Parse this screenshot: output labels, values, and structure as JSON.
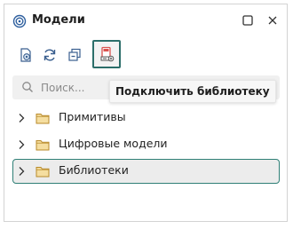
{
  "window": {
    "title": "Модели",
    "app_icon": "spiral-logo-icon",
    "maximize_icon": "maximize-icon",
    "close_icon": "close-icon"
  },
  "toolbar": {
    "buttons": [
      {
        "icon": "document-view-icon"
      },
      {
        "icon": "refresh-icon"
      },
      {
        "icon": "collapse-all-icon"
      },
      {
        "icon": "connect-library-icon",
        "active": true
      }
    ]
  },
  "tooltip": {
    "text": "Подключить библиотеку"
  },
  "search": {
    "placeholder": "Поиск...",
    "value": "",
    "icon": "search-icon"
  },
  "tree": {
    "items": [
      {
        "label": "Примитивы",
        "icon": "folder-icon"
      },
      {
        "label": "Цифровые модели",
        "icon": "folder-icon"
      },
      {
        "label": "Библиотеки",
        "icon": "folder-icon",
        "selected": true
      }
    ]
  },
  "colors": {
    "accent": "#2c6e6a",
    "folder_fill": "#f5dea0",
    "folder_stroke": "#b88a2a",
    "icon_red": "#d9534f",
    "icon_blue": "#3a78c2"
  }
}
